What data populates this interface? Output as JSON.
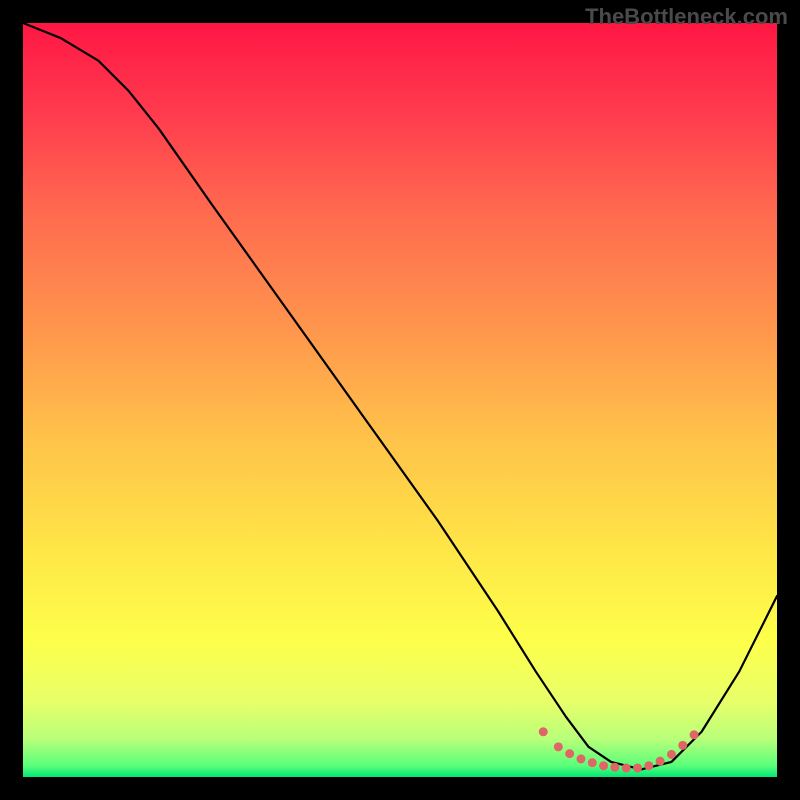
{
  "watermark": "TheBottleneck.com",
  "chart_data": {
    "type": "line",
    "title": "",
    "xlabel": "",
    "ylabel": "",
    "xlim": [
      0,
      100
    ],
    "ylim": [
      0,
      100
    ],
    "grid": false,
    "legend": false,
    "background": {
      "type": "vertical-gradient",
      "stops": [
        {
          "offset": 0.0,
          "color": "#ff1744"
        },
        {
          "offset": 0.12,
          "color": "#ff3b4e"
        },
        {
          "offset": 0.25,
          "color": "#ff6a4f"
        },
        {
          "offset": 0.4,
          "color": "#ff944d"
        },
        {
          "offset": 0.55,
          "color": "#ffc24a"
        },
        {
          "offset": 0.7,
          "color": "#ffe647"
        },
        {
          "offset": 0.82,
          "color": "#fdff4a"
        },
        {
          "offset": 0.9,
          "color": "#e8ff6a"
        },
        {
          "offset": 0.95,
          "color": "#b8ff7a"
        },
        {
          "offset": 0.985,
          "color": "#5aff7a"
        },
        {
          "offset": 1.0,
          "color": "#00e676"
        }
      ]
    },
    "series": [
      {
        "name": "curve",
        "stroke": "#000000",
        "stroke_width": 2.2,
        "x": [
          0,
          5,
          10,
          14,
          18,
          25,
          35,
          45,
          55,
          63,
          68,
          72,
          75,
          78,
          82,
          86,
          90,
          95,
          100
        ],
        "y": [
          100,
          98,
          95,
          91,
          86,
          76,
          62,
          48,
          34,
          22,
          14,
          8,
          4,
          2,
          1,
          2,
          6,
          14,
          24
        ]
      },
      {
        "name": "optimal-band-markers",
        "type": "markers",
        "stroke": "#e06666",
        "marker_size": 4.5,
        "x": [
          69,
          71,
          72.5,
          74,
          75.5,
          77,
          78.5,
          80,
          81.5,
          83,
          84.5,
          86,
          87.5,
          89
        ],
        "y": [
          6.0,
          4.0,
          3.1,
          2.4,
          1.9,
          1.5,
          1.3,
          1.2,
          1.2,
          1.5,
          2.1,
          3.0,
          4.2,
          5.6
        ]
      }
    ]
  }
}
